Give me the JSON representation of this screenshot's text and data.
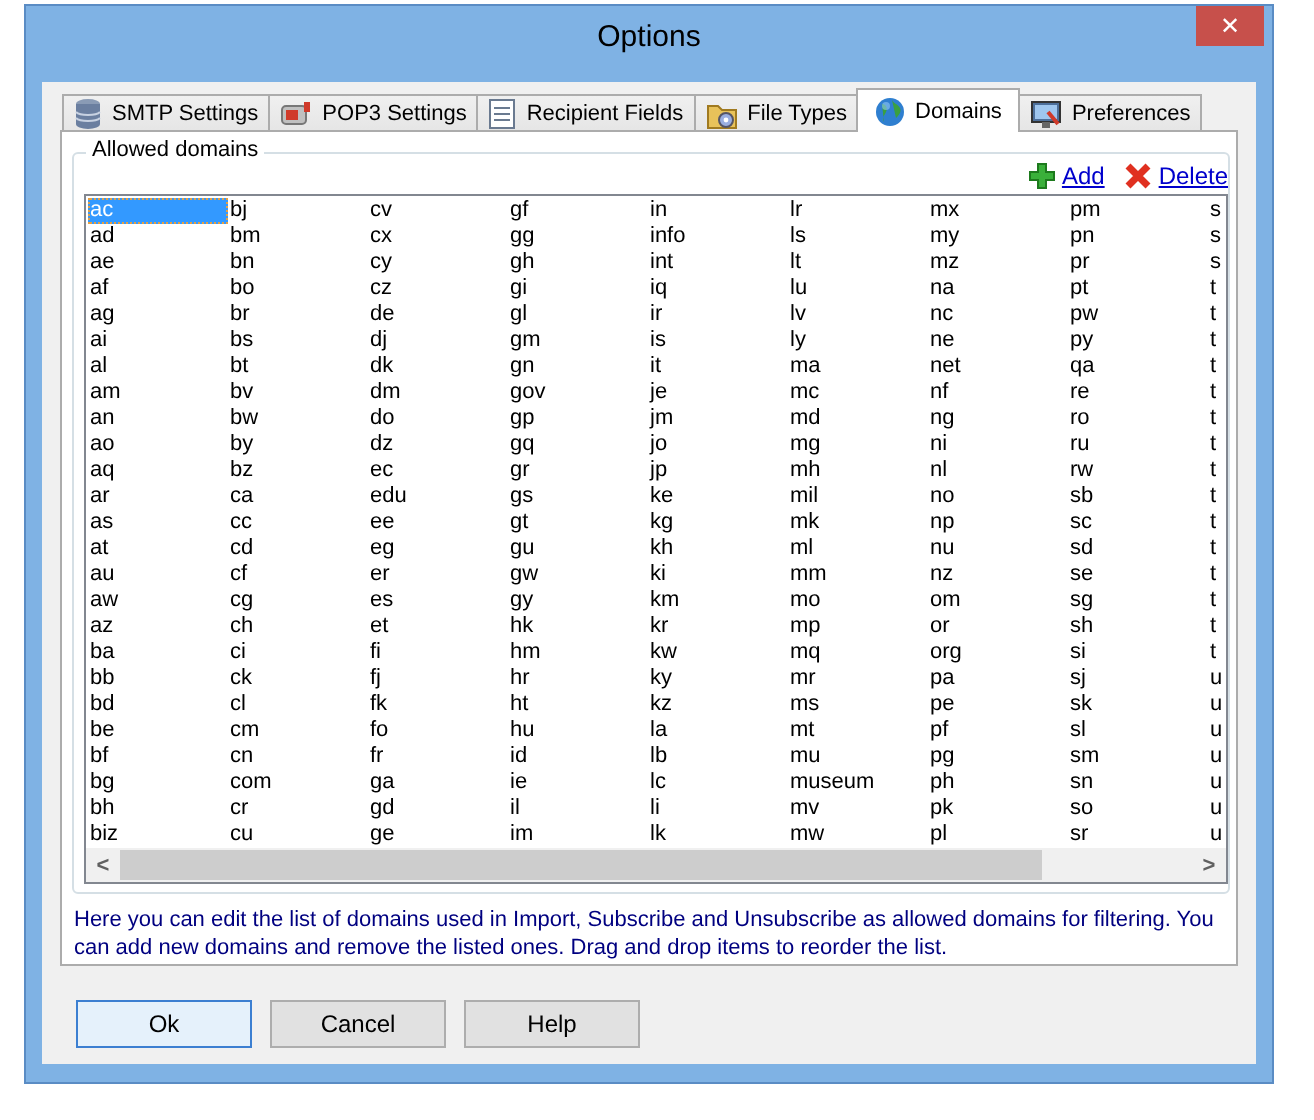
{
  "window": {
    "title": "Options",
    "close_symbol": "✕"
  },
  "tabs": [
    {
      "label": "SMTP Settings",
      "selected": false
    },
    {
      "label": "POP3 Settings",
      "selected": false
    },
    {
      "label": "Recipient Fields",
      "selected": false
    },
    {
      "label": "File Types",
      "selected": false
    },
    {
      "label": "Domains",
      "selected": true
    },
    {
      "label": "Preferences",
      "selected": false
    }
  ],
  "group": {
    "title": "Allowed domains"
  },
  "actions": [
    {
      "kind": "add",
      "label": "Add"
    },
    {
      "kind": "delete",
      "label": "Delete"
    }
  ],
  "domain_columns": [
    [
      {
        "label": "ac",
        "selected": true
      },
      {
        "label": "ad",
        "selected": false
      },
      {
        "label": "ae",
        "selected": false
      },
      {
        "label": "af",
        "selected": false
      },
      {
        "label": "ag",
        "selected": false
      },
      {
        "label": "ai",
        "selected": false
      },
      {
        "label": "al",
        "selected": false
      },
      {
        "label": "am",
        "selected": false
      },
      {
        "label": "an",
        "selected": false
      },
      {
        "label": "ao",
        "selected": false
      },
      {
        "label": "aq",
        "selected": false
      },
      {
        "label": "ar",
        "selected": false
      },
      {
        "label": "as",
        "selected": false
      },
      {
        "label": "at",
        "selected": false
      },
      {
        "label": "au",
        "selected": false
      },
      {
        "label": "aw",
        "selected": false
      },
      {
        "label": "az",
        "selected": false
      },
      {
        "label": "ba",
        "selected": false
      },
      {
        "label": "bb",
        "selected": false
      },
      {
        "label": "bd",
        "selected": false
      },
      {
        "label": "be",
        "selected": false
      },
      {
        "label": "bf",
        "selected": false
      },
      {
        "label": "bg",
        "selected": false
      },
      {
        "label": "bh",
        "selected": false
      },
      {
        "label": "biz",
        "selected": false
      }
    ],
    [
      {
        "label": "bj",
        "selected": false
      },
      {
        "label": "bm",
        "selected": false
      },
      {
        "label": "bn",
        "selected": false
      },
      {
        "label": "bo",
        "selected": false
      },
      {
        "label": "br",
        "selected": false
      },
      {
        "label": "bs",
        "selected": false
      },
      {
        "label": "bt",
        "selected": false
      },
      {
        "label": "bv",
        "selected": false
      },
      {
        "label": "bw",
        "selected": false
      },
      {
        "label": "by",
        "selected": false
      },
      {
        "label": "bz",
        "selected": false
      },
      {
        "label": "ca",
        "selected": false
      },
      {
        "label": "cc",
        "selected": false
      },
      {
        "label": "cd",
        "selected": false
      },
      {
        "label": "cf",
        "selected": false
      },
      {
        "label": "cg",
        "selected": false
      },
      {
        "label": "ch",
        "selected": false
      },
      {
        "label": "ci",
        "selected": false
      },
      {
        "label": "ck",
        "selected": false
      },
      {
        "label": "cl",
        "selected": false
      },
      {
        "label": "cm",
        "selected": false
      },
      {
        "label": "cn",
        "selected": false
      },
      {
        "label": "com",
        "selected": false
      },
      {
        "label": "cr",
        "selected": false
      },
      {
        "label": "cu",
        "selected": false
      }
    ],
    [
      {
        "label": "cv",
        "selected": false
      },
      {
        "label": "cx",
        "selected": false
      },
      {
        "label": "cy",
        "selected": false
      },
      {
        "label": "cz",
        "selected": false
      },
      {
        "label": "de",
        "selected": false
      },
      {
        "label": "dj",
        "selected": false
      },
      {
        "label": "dk",
        "selected": false
      },
      {
        "label": "dm",
        "selected": false
      },
      {
        "label": "do",
        "selected": false
      },
      {
        "label": "dz",
        "selected": false
      },
      {
        "label": "ec",
        "selected": false
      },
      {
        "label": "edu",
        "selected": false
      },
      {
        "label": "ee",
        "selected": false
      },
      {
        "label": "eg",
        "selected": false
      },
      {
        "label": "er",
        "selected": false
      },
      {
        "label": "es",
        "selected": false
      },
      {
        "label": "et",
        "selected": false
      },
      {
        "label": "fi",
        "selected": false
      },
      {
        "label": "fj",
        "selected": false
      },
      {
        "label": "fk",
        "selected": false
      },
      {
        "label": "fo",
        "selected": false
      },
      {
        "label": "fr",
        "selected": false
      },
      {
        "label": "ga",
        "selected": false
      },
      {
        "label": "gd",
        "selected": false
      },
      {
        "label": "ge",
        "selected": false
      }
    ],
    [
      {
        "label": "gf",
        "selected": false
      },
      {
        "label": "gg",
        "selected": false
      },
      {
        "label": "gh",
        "selected": false
      },
      {
        "label": "gi",
        "selected": false
      },
      {
        "label": "gl",
        "selected": false
      },
      {
        "label": "gm",
        "selected": false
      },
      {
        "label": "gn",
        "selected": false
      },
      {
        "label": "gov",
        "selected": false
      },
      {
        "label": "gp",
        "selected": false
      },
      {
        "label": "gq",
        "selected": false
      },
      {
        "label": "gr",
        "selected": false
      },
      {
        "label": "gs",
        "selected": false
      },
      {
        "label": "gt",
        "selected": false
      },
      {
        "label": "gu",
        "selected": false
      },
      {
        "label": "gw",
        "selected": false
      },
      {
        "label": "gy",
        "selected": false
      },
      {
        "label": "hk",
        "selected": false
      },
      {
        "label": "hm",
        "selected": false
      },
      {
        "label": "hr",
        "selected": false
      },
      {
        "label": "ht",
        "selected": false
      },
      {
        "label": "hu",
        "selected": false
      },
      {
        "label": "id",
        "selected": false
      },
      {
        "label": "ie",
        "selected": false
      },
      {
        "label": "il",
        "selected": false
      },
      {
        "label": "im",
        "selected": false
      }
    ],
    [
      {
        "label": "in",
        "selected": false
      },
      {
        "label": "info",
        "selected": false
      },
      {
        "label": "int",
        "selected": false
      },
      {
        "label": "iq",
        "selected": false
      },
      {
        "label": "ir",
        "selected": false
      },
      {
        "label": "is",
        "selected": false
      },
      {
        "label": "it",
        "selected": false
      },
      {
        "label": "je",
        "selected": false
      },
      {
        "label": "jm",
        "selected": false
      },
      {
        "label": "jo",
        "selected": false
      },
      {
        "label": "jp",
        "selected": false
      },
      {
        "label": "ke",
        "selected": false
      },
      {
        "label": "kg",
        "selected": false
      },
      {
        "label": "kh",
        "selected": false
      },
      {
        "label": "ki",
        "selected": false
      },
      {
        "label": "km",
        "selected": false
      },
      {
        "label": "kr",
        "selected": false
      },
      {
        "label": "kw",
        "selected": false
      },
      {
        "label": "ky",
        "selected": false
      },
      {
        "label": "kz",
        "selected": false
      },
      {
        "label": "la",
        "selected": false
      },
      {
        "label": "lb",
        "selected": false
      },
      {
        "label": "lc",
        "selected": false
      },
      {
        "label": "li",
        "selected": false
      },
      {
        "label": "lk",
        "selected": false
      }
    ],
    [
      {
        "label": "lr",
        "selected": false
      },
      {
        "label": "ls",
        "selected": false
      },
      {
        "label": "lt",
        "selected": false
      },
      {
        "label": "lu",
        "selected": false
      },
      {
        "label": "lv",
        "selected": false
      },
      {
        "label": "ly",
        "selected": false
      },
      {
        "label": "ma",
        "selected": false
      },
      {
        "label": "mc",
        "selected": false
      },
      {
        "label": "md",
        "selected": false
      },
      {
        "label": "mg",
        "selected": false
      },
      {
        "label": "mh",
        "selected": false
      },
      {
        "label": "mil",
        "selected": false
      },
      {
        "label": "mk",
        "selected": false
      },
      {
        "label": "ml",
        "selected": false
      },
      {
        "label": "mm",
        "selected": false
      },
      {
        "label": "mo",
        "selected": false
      },
      {
        "label": "mp",
        "selected": false
      },
      {
        "label": "mq",
        "selected": false
      },
      {
        "label": "mr",
        "selected": false
      },
      {
        "label": "ms",
        "selected": false
      },
      {
        "label": "mt",
        "selected": false
      },
      {
        "label": "mu",
        "selected": false
      },
      {
        "label": "museum",
        "selected": false
      },
      {
        "label": "mv",
        "selected": false
      },
      {
        "label": "mw",
        "selected": false
      }
    ],
    [
      {
        "label": "mx",
        "selected": false
      },
      {
        "label": "my",
        "selected": false
      },
      {
        "label": "mz",
        "selected": false
      },
      {
        "label": "na",
        "selected": false
      },
      {
        "label": "nc",
        "selected": false
      },
      {
        "label": "ne",
        "selected": false
      },
      {
        "label": "net",
        "selected": false
      },
      {
        "label": "nf",
        "selected": false
      },
      {
        "label": "ng",
        "selected": false
      },
      {
        "label": "ni",
        "selected": false
      },
      {
        "label": "nl",
        "selected": false
      },
      {
        "label": "no",
        "selected": false
      },
      {
        "label": "np",
        "selected": false
      },
      {
        "label": "nu",
        "selected": false
      },
      {
        "label": "nz",
        "selected": false
      },
      {
        "label": "om",
        "selected": false
      },
      {
        "label": "or",
        "selected": false
      },
      {
        "label": "org",
        "selected": false
      },
      {
        "label": "pa",
        "selected": false
      },
      {
        "label": "pe",
        "selected": false
      },
      {
        "label": "pf",
        "selected": false
      },
      {
        "label": "pg",
        "selected": false
      },
      {
        "label": "ph",
        "selected": false
      },
      {
        "label": "pk",
        "selected": false
      },
      {
        "label": "pl",
        "selected": false
      }
    ],
    [
      {
        "label": "pm",
        "selected": false
      },
      {
        "label": "pn",
        "selected": false
      },
      {
        "label": "pr",
        "selected": false
      },
      {
        "label": "pt",
        "selected": false
      },
      {
        "label": "pw",
        "selected": false
      },
      {
        "label": "py",
        "selected": false
      },
      {
        "label": "qa",
        "selected": false
      },
      {
        "label": "re",
        "selected": false
      },
      {
        "label": "ro",
        "selected": false
      },
      {
        "label": "ru",
        "selected": false
      },
      {
        "label": "rw",
        "selected": false
      },
      {
        "label": "sb",
        "selected": false
      },
      {
        "label": "sc",
        "selected": false
      },
      {
        "label": "sd",
        "selected": false
      },
      {
        "label": "se",
        "selected": false
      },
      {
        "label": "sg",
        "selected": false
      },
      {
        "label": "sh",
        "selected": false
      },
      {
        "label": "si",
        "selected": false
      },
      {
        "label": "sj",
        "selected": false
      },
      {
        "label": "sk",
        "selected": false
      },
      {
        "label": "sl",
        "selected": false
      },
      {
        "label": "sm",
        "selected": false
      },
      {
        "label": "sn",
        "selected": false
      },
      {
        "label": "so",
        "selected": false
      },
      {
        "label": "sr",
        "selected": false
      }
    ],
    [
      {
        "label": "s",
        "selected": false
      },
      {
        "label": "s",
        "selected": false
      },
      {
        "label": "s",
        "selected": false
      },
      {
        "label": "t",
        "selected": false
      },
      {
        "label": "t",
        "selected": false
      },
      {
        "label": "t",
        "selected": false
      },
      {
        "label": "t",
        "selected": false
      },
      {
        "label": "t",
        "selected": false
      },
      {
        "label": "t",
        "selected": false
      },
      {
        "label": "t",
        "selected": false
      },
      {
        "label": "t",
        "selected": false
      },
      {
        "label": "t",
        "selected": false
      },
      {
        "label": "t",
        "selected": false
      },
      {
        "label": "t",
        "selected": false
      },
      {
        "label": "t",
        "selected": false
      },
      {
        "label": "t",
        "selected": false
      },
      {
        "label": "t",
        "selected": false
      },
      {
        "label": "t",
        "selected": false
      },
      {
        "label": "u",
        "selected": false
      },
      {
        "label": "u",
        "selected": false
      },
      {
        "label": "u",
        "selected": false
      },
      {
        "label": "u",
        "selected": false
      },
      {
        "label": "u",
        "selected": false
      },
      {
        "label": "u",
        "selected": false
      },
      {
        "label": "u",
        "selected": false
      }
    ]
  ],
  "scrollbar": {
    "left_arrow": "<",
    "right_arrow": ">"
  },
  "help_text": "Here you can edit the list of domains used in Import, Subscribe and Unsubscribe as allowed domains for filtering. You can add new domains and remove the listed ones. Drag and drop items to reorder the list.",
  "buttons": [
    {
      "label": "Ok",
      "focused": true
    },
    {
      "label": "Cancel",
      "focused": false
    },
    {
      "label": "Help",
      "focused": false
    }
  ]
}
